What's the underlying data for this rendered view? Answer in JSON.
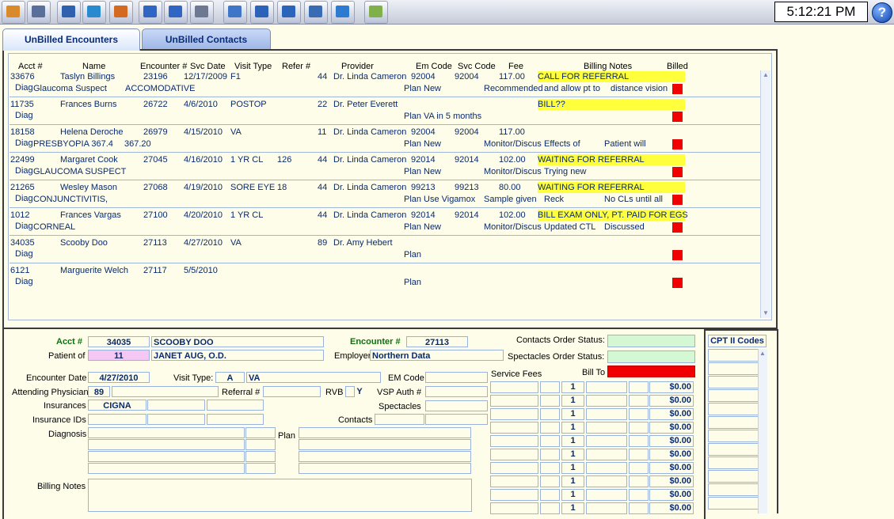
{
  "clock": "5:12:21 PM",
  "help_label": "?",
  "tabs": {
    "unbilled_encounters": "UnBilled Encounters",
    "unbilled_contacts": "UnBilled Contacts"
  },
  "grid": {
    "headers": {
      "acct": "Acct #",
      "name": "Name",
      "encounter": "Encounter #",
      "svc_date": "Svc Date",
      "visit_type": "Visit Type",
      "refer": "Refer #",
      "provider": "Provider",
      "em_code": "Em Code",
      "svc_code": "Svc Code",
      "fee": "Fee",
      "billing_notes": "Billing Notes",
      "billed": "Billed"
    },
    "rows": [
      {
        "acct": "33676",
        "name": "Taslyn Billings",
        "enc": "23196",
        "date": "12/17/2009",
        "vt": "F1",
        "vt2": "",
        "refer": "44",
        "provider": "Dr. Linda Cameron",
        "em": "92004",
        "svc": "92004",
        "fee": "117.00",
        "note1": "CALL FOR REFERRAL",
        "note1_hl": true,
        "diag": "Glaucoma Suspect",
        "diag2": "ACCOMODATIVE",
        "plan": "New",
        "rec": "Recommended",
        "note2": "and allow pt to",
        "note3": "distance vision"
      },
      {
        "acct": "11735",
        "name": "Frances Burns",
        "enc": "26722",
        "date": "4/6/2010",
        "vt": "POSTOP",
        "vt2": "",
        "refer": "22",
        "provider": "Dr. Peter Everett",
        "em": "",
        "svc": "",
        "fee": "",
        "note1": "BILL??",
        "note1_hl": true,
        "diag": "",
        "diag2": "",
        "plan": "VA in 5 months",
        "rec": "",
        "note2": "",
        "note3": ""
      },
      {
        "acct": "18158",
        "name": "Helena Deroche",
        "enc": "26979",
        "date": "4/15/2010",
        "vt": "VA",
        "vt2": "",
        "refer": "11",
        "provider": "Dr. Linda Cameron",
        "em": "92004",
        "svc": "92004",
        "fee": "117.00",
        "note1": "",
        "note1_hl": false,
        "diag": "PRESBYOPIA 367.4",
        "diag2": "367.20",
        "plan": "New",
        "rec": "Monitor/Discus",
        "note2": "Effects of",
        "note3": "Patient will"
      },
      {
        "acct": "22499",
        "name": "Margaret Cook",
        "enc": "27045",
        "date": "4/16/2010",
        "vt": "1 YR CL",
        "vt2": "126",
        "refer": "44",
        "provider": "Dr. Linda Cameron",
        "em": "92014",
        "svc": "92014",
        "fee": "102.00",
        "note1": "WAITING FOR REFERRAL",
        "note1_hl": true,
        "diag": "GLAUCOMA SUSPECT",
        "diag2": "",
        "plan": "New",
        "rec": "Monitor/Discus",
        "note2": "Trying new",
        "note3": ""
      },
      {
        "acct": "21265",
        "name": "Wesley Mason",
        "enc": "27068",
        "date": "4/19/2010",
        "vt": "SORE EYE",
        "vt2": "18",
        "refer": "44",
        "provider": "Dr. Linda Cameron",
        "em": "99213",
        "svc": "99213",
        "fee": "80.00",
        "note1": "WAITING FOR REFERRAL",
        "note1_hl": true,
        "diag": "CONJUNCTIVITIS,",
        "diag2": "",
        "plan": "Use Vigamox",
        "rec": "Sample given",
        "note2": "Reck",
        "note3": "No CLs until all"
      },
      {
        "acct": "1012",
        "name": "Frances Vargas",
        "enc": "27100",
        "date": "4/20/2010",
        "vt": "1 YR CL",
        "vt2": "",
        "refer": "44",
        "provider": "Dr. Linda Cameron",
        "em": "92014",
        "svc": "92014",
        "fee": "102.00",
        "note1": "BILL EXAM ONLY, PT. PAID FOR EGS",
        "note1_hl": true,
        "diag": "CORNEAL",
        "diag2": "",
        "plan": "New",
        "rec": "Monitor/Discus",
        "note2": "Updated CTL",
        "note3": "Discussed"
      },
      {
        "acct": "34035",
        "name": "Scooby Doo",
        "enc": "27113",
        "date": "4/27/2010",
        "vt": "VA",
        "vt2": "",
        "refer": "89",
        "provider": "Dr. Amy Hebert",
        "em": "",
        "svc": "",
        "fee": "",
        "note1": "",
        "note1_hl": false,
        "diag": "",
        "diag2": "",
        "plan": "",
        "rec": "",
        "note2": "",
        "note3": ""
      },
      {
        "acct": "6121",
        "name": "Marguerite Welch",
        "enc": "27117",
        "date": "5/5/2010",
        "vt": "",
        "vt2": "",
        "refer": "",
        "provider": "",
        "em": "",
        "svc": "",
        "fee": "",
        "note1": "",
        "note1_hl": false,
        "diag": "",
        "diag2": "",
        "plan": "",
        "rec": "",
        "note2": "",
        "note3": ""
      }
    ],
    "diag_label": "Diag",
    "plan_label": "Plan"
  },
  "detail": {
    "acct_label": "Acct #",
    "acct": "34035",
    "acct_name": "SCOOBY DOO",
    "encounter_label": "Encounter #",
    "encounter": "27113",
    "patient_of_label": "Patient of",
    "patient_of": "11",
    "patient_of_name": "JANET AUG, O.D.",
    "employer_label": "Employer",
    "employer": "Northern Data",
    "contacts_order_label": "Contacts Order Status:",
    "spectacles_order_label": "Spectacles Order Status:",
    "encounter_date_label": "Encounter Date",
    "encounter_date": "4/27/2010",
    "visit_type_label": "Visit Type:",
    "visit_type_code": "A",
    "visit_type": "VA",
    "em_code_label": "EM Code",
    "service_fees_label": "Service Fees",
    "bill_to_label": "Bill To",
    "attending_label": "Attending Physician",
    "attending": "89",
    "referral_label": "Referral #",
    "rvb_label": "RVB",
    "rvb": "Y",
    "vsp_label": "VSP Auth #",
    "insurances_label": "Insurances",
    "insurance": "CIGNA",
    "spectacles_label": "Spectacles",
    "insurance_ids_label": "Insurance IDs",
    "contacts_label": "Contacts",
    "diagnosis_label": "Diagnosis",
    "plan_label": "Plan",
    "billing_notes_label": "Billing Notes",
    "fee_rows": [
      {
        "qty": "1",
        "amount": "$0.00"
      },
      {
        "qty": "1",
        "amount": "$0.00"
      },
      {
        "qty": "1",
        "amount": "$0.00"
      },
      {
        "qty": "1",
        "amount": "$0.00"
      },
      {
        "qty": "1",
        "amount": "$0.00"
      },
      {
        "qty": "1",
        "amount": "$0.00"
      },
      {
        "qty": "1",
        "amount": "$0.00"
      },
      {
        "qty": "1",
        "amount": "$0.00"
      },
      {
        "qty": "1",
        "amount": "$0.00"
      },
      {
        "qty": "1",
        "amount": "$0.00"
      }
    ]
  },
  "cpt": {
    "title": "CPT II Codes"
  },
  "colors": {
    "highlight": "#ffff3c",
    "billed_red": "#f00000",
    "status_green": "#d4f7d4",
    "bill_to_red": "#f00000",
    "patient_pink": "#f4c8f2",
    "label_green": "#107010"
  },
  "toolbar_icons": [
    "home-icon",
    "people-icon",
    "building-icon",
    "pill-icon",
    "hat-icon",
    "document-search-icon",
    "document-search-2-icon",
    "printer-icon",
    "edit-screen-icon",
    "clock-screen-icon",
    "screen-icon",
    "magnify-doc-icon",
    "hardware-icon",
    "edit-note-icon"
  ]
}
